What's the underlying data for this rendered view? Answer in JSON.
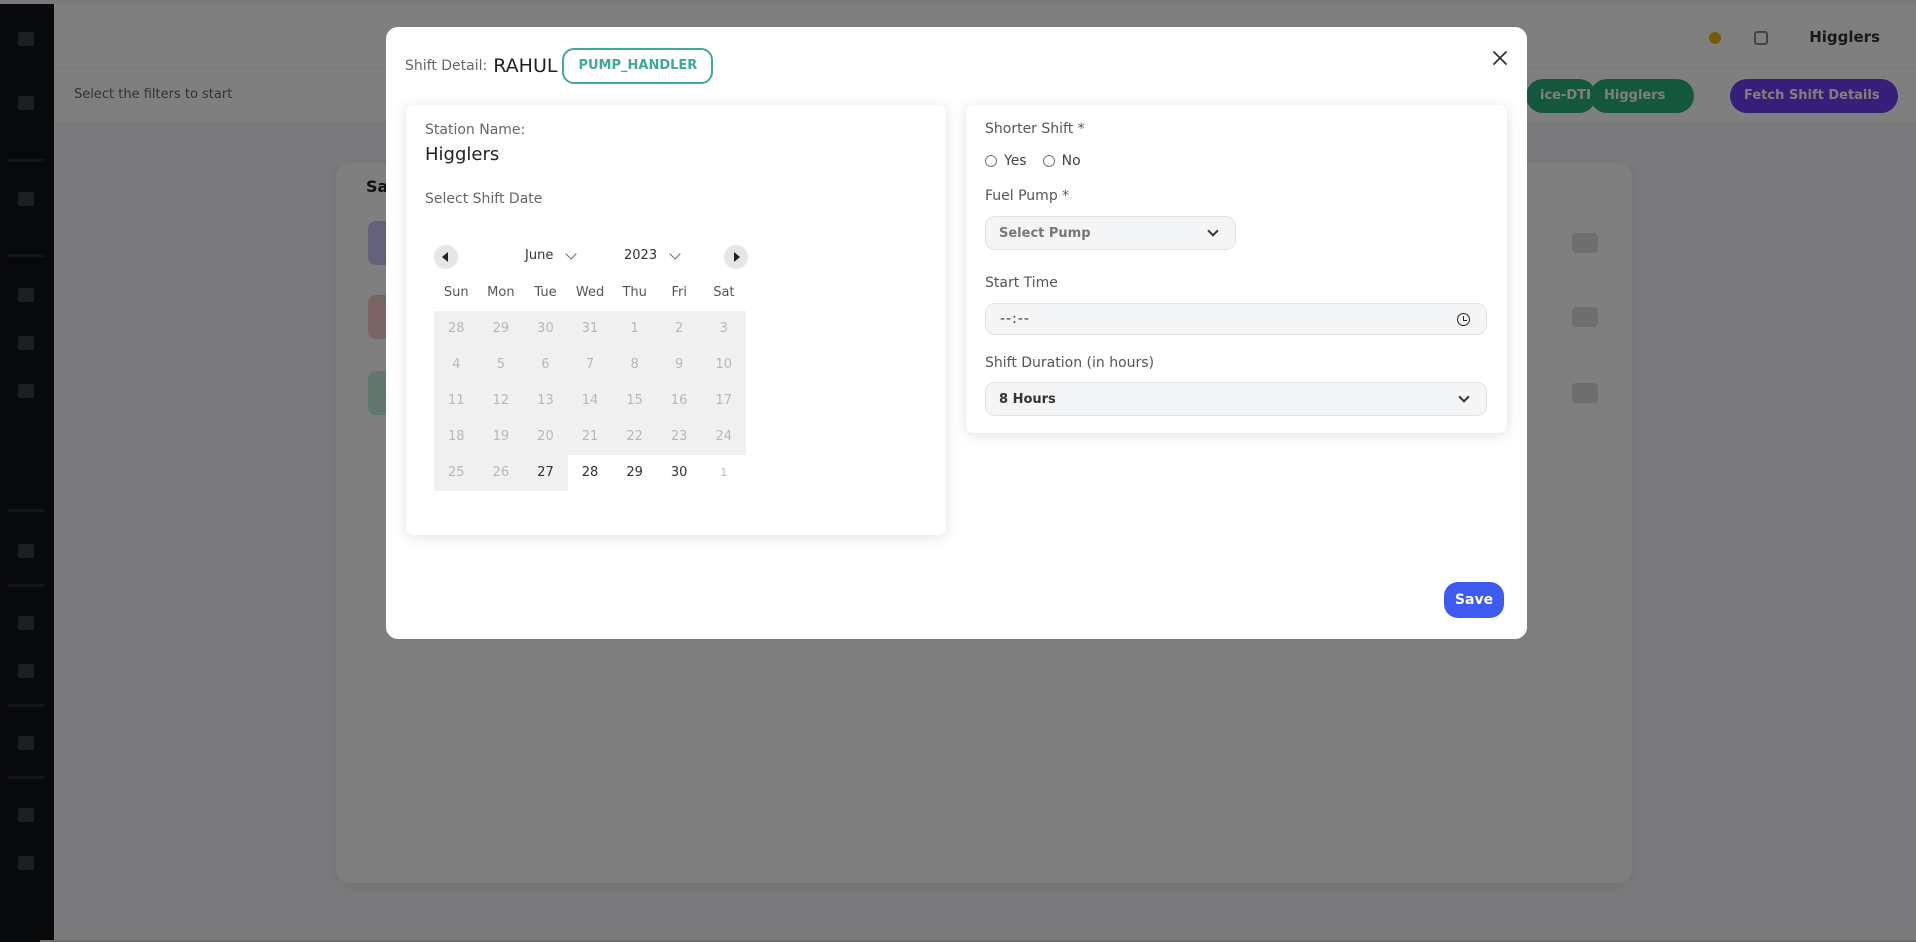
{
  "background": {
    "topbar": {
      "user_name": "Higglers"
    },
    "filters": {
      "hint": "Select the filters to start",
      "buttons": [
        "ice-DTK",
        "Higglers",
        "Fetch Shift Details"
      ]
    },
    "card": {
      "title": "Sa"
    }
  },
  "modal": {
    "detail_label": "Shift Detail:",
    "employee_name": "RAHUL",
    "role_badge": "PUMP_HANDLER",
    "station_name_label": "Station Name:",
    "station_name": "Higglers",
    "select_date_label": "Select Shift Date",
    "calendar": {
      "month": "June",
      "year": "2023",
      "weekdays": [
        "Sun",
        "Mon",
        "Tue",
        "Wed",
        "Thu",
        "Fri",
        "Sat"
      ],
      "weeks": [
        [
          "28",
          "29",
          "30",
          "31",
          "1",
          "2",
          "3"
        ],
        [
          "4",
          "5",
          "6",
          "7",
          "8",
          "9",
          "10"
        ],
        [
          "11",
          "12",
          "13",
          "14",
          "15",
          "16",
          "17"
        ],
        [
          "18",
          "19",
          "20",
          "21",
          "22",
          "23",
          "24"
        ],
        [
          "25",
          "26",
          "27",
          "28",
          "29",
          "30",
          "1"
        ]
      ],
      "selected": "27"
    },
    "shorter_shift_label": "Shorter Shift *",
    "shorter_shift_options": [
      "Yes",
      "No"
    ],
    "fuel_pump_label": "Fuel Pump *",
    "fuel_pump_placeholder": "Select Pump",
    "start_time_label": "Start Time",
    "start_time_value": "--:--",
    "shift_duration_label": "Shift Duration (in hours)",
    "shift_duration_value": "8 Hours",
    "save_label": "Save"
  }
}
